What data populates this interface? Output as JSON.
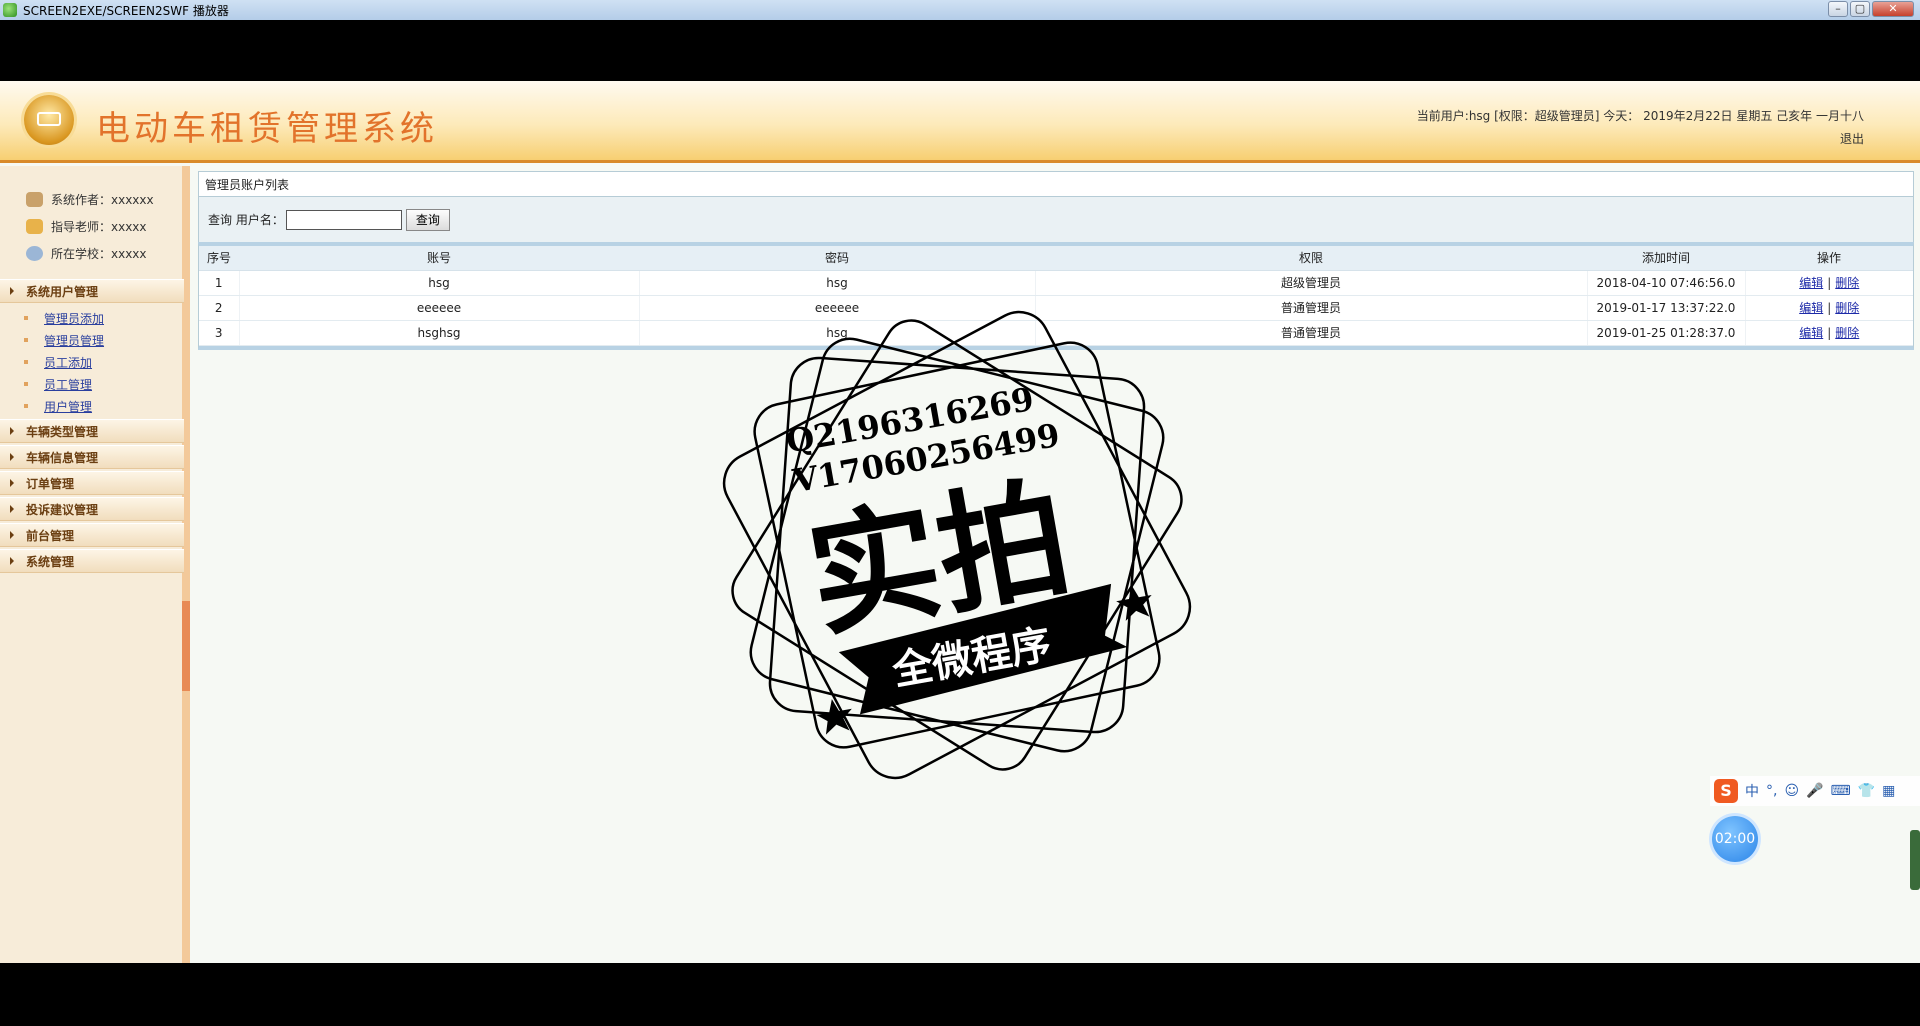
{
  "window": {
    "title": "SCREEN2EXE/SCREEN2SWF 播放器",
    "buttons": [
      "–",
      "▢",
      "✕"
    ]
  },
  "header": {
    "title": "电动车租赁管理系统",
    "user_info": "当前用户:hsg [权限：超级管理员] 今天： 2019年2月22日 星期五 己亥年 一月十八",
    "logout": "退出"
  },
  "sidebar": {
    "info": [
      {
        "label": "系统作者：xxxxxx",
        "icon": "author-icon"
      },
      {
        "label": "指导老师：xxxxx",
        "icon": "teacher-icon"
      },
      {
        "label": "所在学校：xxxxx",
        "icon": "school-icon"
      }
    ],
    "menus": [
      {
        "label": "系统用户管理",
        "items": [
          "管理员添加",
          "管理员管理",
          "员工添加",
          "员工管理",
          "用户管理"
        ]
      },
      {
        "label": "车辆类型管理"
      },
      {
        "label": "车辆信息管理"
      },
      {
        "label": "订单管理"
      },
      {
        "label": "投诉建议管理"
      },
      {
        "label": "前台管理"
      },
      {
        "label": "系统管理"
      }
    ]
  },
  "main": {
    "panel_title": "管理员账户列表",
    "query_label": "查询 用户名：",
    "query_value": "",
    "query_button": "查询",
    "table": {
      "headers": [
        "序号",
        "账号",
        "密码",
        "权限",
        "添加时间",
        "操作"
      ],
      "rows": [
        [
          "1",
          "hsg",
          "hsg",
          "超级管理员",
          "2018-04-10 07:46:56.0"
        ],
        [
          "2",
          "eeeeee",
          "eeeeee",
          "普通管理员",
          "2019-01-17 13:37:22.0"
        ],
        [
          "3",
          "hsghsg",
          "hsg",
          "普通管理员",
          "2019-01-25 01:28:37.0"
        ]
      ],
      "edit_label": "编辑",
      "delete_label": "删除",
      "separator": "|"
    }
  },
  "watermark": {
    "line1": "Q2196316269",
    "line2": "V17060256499",
    "big_text": "实拍",
    "banner_text": "全微程序"
  },
  "ime": {
    "logo": "S",
    "items": [
      "中",
      "°,",
      "☺",
      "🎤",
      "⌨",
      "👕",
      "▦"
    ]
  },
  "timer": "02:00"
}
